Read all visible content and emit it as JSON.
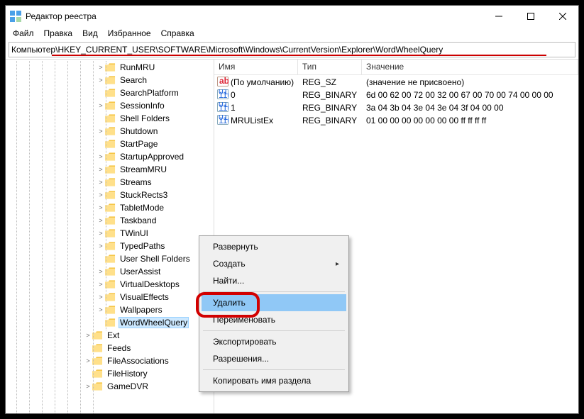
{
  "window": {
    "title": "Редактор реестра"
  },
  "menubar": [
    "Файл",
    "Правка",
    "Вид",
    "Избранное",
    "Справка"
  ],
  "addressbar": {
    "path": "Компьютер\\HKEY_CURRENT_USER\\SOFTWARE\\Microsoft\\Windows\\CurrentVersion\\Explorer\\WordWheelQuery"
  },
  "tree": [
    {
      "indent": 7,
      "expander": ">",
      "label": "RunMRU"
    },
    {
      "indent": 7,
      "expander": ">",
      "label": "Search"
    },
    {
      "indent": 7,
      "expander": "",
      "label": "SearchPlatform"
    },
    {
      "indent": 7,
      "expander": ">",
      "label": "SessionInfo"
    },
    {
      "indent": 7,
      "expander": "",
      "label": "Shell Folders"
    },
    {
      "indent": 7,
      "expander": ">",
      "label": "Shutdown"
    },
    {
      "indent": 7,
      "expander": "",
      "label": "StartPage"
    },
    {
      "indent": 7,
      "expander": ">",
      "label": "StartupApproved"
    },
    {
      "indent": 7,
      "expander": ">",
      "label": "StreamMRU"
    },
    {
      "indent": 7,
      "expander": ">",
      "label": "Streams"
    },
    {
      "indent": 7,
      "expander": ">",
      "label": "StuckRects3"
    },
    {
      "indent": 7,
      "expander": ">",
      "label": "TabletMode"
    },
    {
      "indent": 7,
      "expander": ">",
      "label": "Taskband"
    },
    {
      "indent": 7,
      "expander": ">",
      "label": "TWinUI"
    },
    {
      "indent": 7,
      "expander": ">",
      "label": "TypedPaths"
    },
    {
      "indent": 7,
      "expander": "",
      "label": "User Shell Folders"
    },
    {
      "indent": 7,
      "expander": ">",
      "label": "UserAssist"
    },
    {
      "indent": 7,
      "expander": ">",
      "label": "VirtualDesktops"
    },
    {
      "indent": 7,
      "expander": ">",
      "label": "VisualEffects"
    },
    {
      "indent": 7,
      "expander": ">",
      "label": "Wallpapers"
    },
    {
      "indent": 7,
      "expander": "",
      "label": "WordWheelQuery",
      "selected": true
    },
    {
      "indent": 6,
      "expander": ">",
      "label": "Ext"
    },
    {
      "indent": 6,
      "expander": "",
      "label": "Feeds"
    },
    {
      "indent": 6,
      "expander": ">",
      "label": "FileAssociations"
    },
    {
      "indent": 6,
      "expander": "",
      "label": "FileHistory"
    },
    {
      "indent": 6,
      "expander": ">",
      "label": "GameDVR"
    }
  ],
  "columns": {
    "name": "Имя",
    "type": "Тип",
    "value": "Значение"
  },
  "values": [
    {
      "icon": "sz",
      "name": "(По умолчанию)",
      "type": "REG_SZ",
      "value": "(значение не присвоено)"
    },
    {
      "icon": "bin",
      "name": "0",
      "type": "REG_BINARY",
      "value": "6d 00 62 00 72 00 32 00 67 00 70 00 74 00 00 00"
    },
    {
      "icon": "bin",
      "name": "1",
      "type": "REG_BINARY",
      "value": "3a 04 3b 04 3e 04 3e 04 3f 04 00 00"
    },
    {
      "icon": "bin",
      "name": "MRUListEx",
      "type": "REG_BINARY",
      "value": "01 00 00 00 00 00 00 00 ff ff ff ff"
    }
  ],
  "context_menu": [
    {
      "label": "Развернуть"
    },
    {
      "label": "Создать",
      "sub": true
    },
    {
      "label": "Найти..."
    },
    {
      "sep": true
    },
    {
      "label": "Удалить",
      "hover": true
    },
    {
      "label": "Переименовать"
    },
    {
      "sep": true
    },
    {
      "label": "Экспортировать"
    },
    {
      "label": "Разрешения..."
    },
    {
      "sep": true
    },
    {
      "label": "Копировать имя раздела"
    }
  ]
}
